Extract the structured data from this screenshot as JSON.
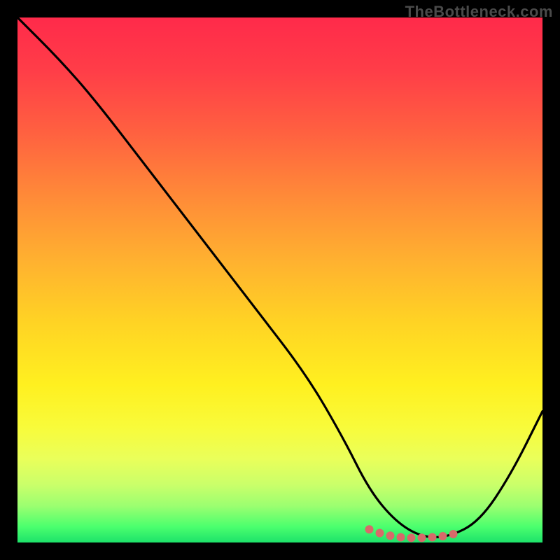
{
  "watermark": "TheBottleneck.com",
  "chart_data": {
    "type": "line",
    "title": "",
    "xlabel": "",
    "ylabel": "",
    "ylim": [
      0,
      100
    ],
    "xlim": [
      0,
      100
    ],
    "series": [
      {
        "name": "bottleneck-curve",
        "x": [
          0,
          8,
          15,
          25,
          35,
          45,
          55,
          62,
          67,
          72,
          77,
          82,
          88,
          94,
          100
        ],
        "values": [
          100,
          92,
          84,
          71,
          58,
          45,
          32,
          20,
          10,
          4,
          1,
          1,
          4,
          13,
          25
        ]
      },
      {
        "name": "optimal-range-dots",
        "x": [
          67,
          69,
          71,
          73,
          75,
          77,
          79,
          81,
          83
        ],
        "values": [
          2.5,
          1.8,
          1.3,
          1.0,
          0.9,
          0.9,
          1.0,
          1.2,
          1.6
        ]
      }
    ],
    "colors": {
      "curve": "#000000",
      "dots": "#d76a6a"
    }
  }
}
